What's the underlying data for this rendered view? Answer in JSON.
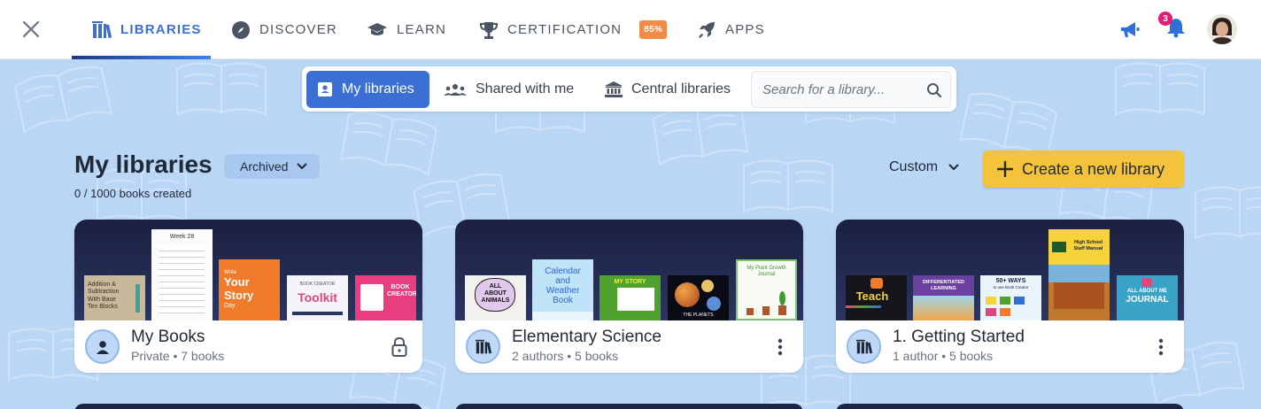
{
  "nav": {
    "close_icon": "close-icon",
    "items": [
      {
        "label": "LIBRARIES",
        "icon": "libraries-icon",
        "active": true
      },
      {
        "label": "DISCOVER",
        "icon": "compass-icon"
      },
      {
        "label": "LEARN",
        "icon": "graduation-cap-icon"
      },
      {
        "label": "CERTIFICATION",
        "icon": "trophy-icon",
        "badge": "85%"
      },
      {
        "label": "APPS",
        "icon": "rocket-icon"
      }
    ],
    "notifications_count": "3",
    "colors": {
      "accent": "#3b6fd4",
      "badge": "#f28b45",
      "notify": "#e11d74"
    }
  },
  "filters": {
    "tabs": [
      {
        "label": "My libraries",
        "icon": "person-badge-icon",
        "active": true
      },
      {
        "label": "Shared with me",
        "icon": "people-icon"
      },
      {
        "label": "Central libraries",
        "icon": "institution-icon"
      }
    ],
    "search_placeholder": "Search for a library..."
  },
  "header": {
    "title": "My libraries",
    "archived_label": "Archived",
    "books_created": "0 / 1000 books created",
    "sort_label": "Custom",
    "create_label": "Create a new library"
  },
  "cards": [
    {
      "name": "My Books",
      "meta": "Private • 7 books",
      "icon": "user-icon",
      "action_icon": "lock-icon",
      "covers": {
        "addition": [
          "Addition &",
          "Subtraction",
          "With Base",
          "Ten Blocks"
        ],
        "week": "Week 28",
        "story": [
          "Write",
          "Your",
          "Story",
          "Day"
        ],
        "toolkit": [
          "BOOK CREATOR",
          "Toolkit"
        ],
        "book": [
          "BOOK",
          "CREATOR"
        ]
      }
    },
    {
      "name": "Elementary Science",
      "meta": "2 authors • 5 books",
      "icon": "libraries-icon",
      "action_icon": "more-vertical-icon",
      "covers": {
        "animals": [
          "ALL",
          "ABOUT",
          "ANIMALS"
        ],
        "calendar": [
          "Calendar",
          "and",
          "Weather",
          "Book"
        ],
        "story": "MY STORY",
        "planets": "THE PLANETS",
        "plant": [
          "My Plant Growth",
          "Journal"
        ]
      }
    },
    {
      "name": "1. Getting Started",
      "meta": "1 author • 5 books",
      "icon": "libraries-icon",
      "action_icon": "more-vertical-icon",
      "covers": {
        "teach": "Teach",
        "diff": [
          "DIFFERENTIATED",
          "LEARNING"
        ],
        "ways": [
          "50+ WAYS",
          "to use Book Creator"
        ],
        "manual": [
          "High School",
          "Staff Manual"
        ],
        "journal": [
          "ALL ABOUT ME",
          "JOURNAL"
        ]
      }
    }
  ]
}
